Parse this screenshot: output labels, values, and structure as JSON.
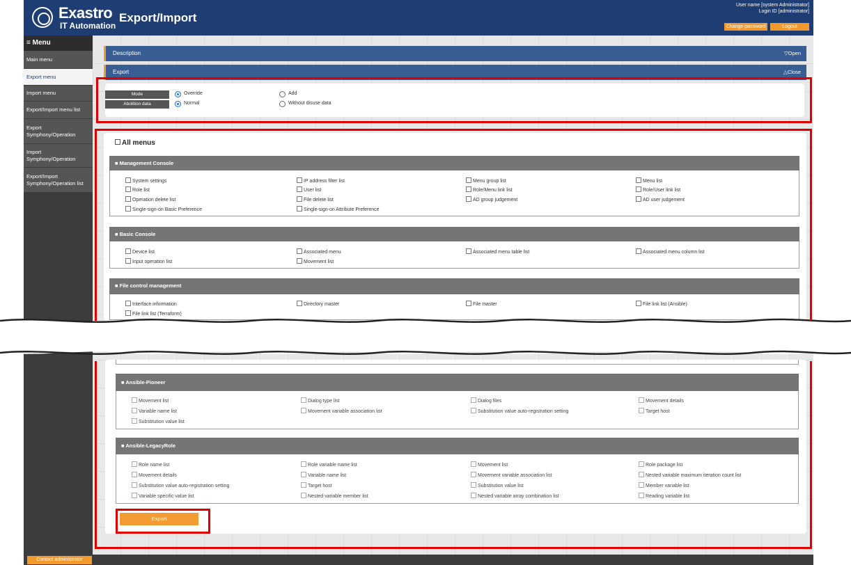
{
  "header": {
    "logo_name": "Exastro",
    "logo_sub": "IT Automation",
    "title": "Export/Import",
    "user_name": "User name [system Administrator]",
    "login_id": "Login ID [administrator]",
    "change_password": "Change password",
    "logout": "Logout"
  },
  "sidebar": {
    "heading": "≡ Menu",
    "items": [
      {
        "label": "Main menu"
      },
      {
        "label": "Export menu"
      },
      {
        "label": "Import menu"
      },
      {
        "label": "Export/Import menu list"
      },
      {
        "label": "Export Symphony/Operation"
      },
      {
        "label": "Import Symphony/Operation"
      },
      {
        "label": "Export/Import Symphony/Operation list"
      }
    ]
  },
  "bars": {
    "description": "Description",
    "description_toggle": "▽Open",
    "export": "Export",
    "export_toggle": "△Close"
  },
  "mode": {
    "mode_label": "Mode",
    "abolition_label": "Abolition data",
    "override": "Override",
    "add": "Add",
    "normal": "Normal",
    "without_disuse": "Without disuse data"
  },
  "all_menus": "All menus",
  "groups": {
    "mgmt": {
      "title": "Management Console",
      "items": [
        "System settings",
        "IP address filter list",
        "Menu group list",
        "Menu list",
        "Role list",
        "User list",
        "Role/Menu link list",
        "Role/User link list",
        "Operation delete list",
        "File delete list",
        "AD group judgement",
        "AD user judgement",
        "Single-sign-on Basic Preference",
        "Single-sign-on Attribute Preference"
      ]
    },
    "basic": {
      "title": "Basic Console",
      "items": [
        "Device list",
        "Associated menu",
        "Associated menu table list",
        "Associated menu column list",
        "Input operation list",
        "Movement list"
      ]
    },
    "file": {
      "title": "File control management",
      "items": [
        "Interface information",
        "Directory master",
        "File master",
        "File link list (Ansible)",
        "File link list (Terraform)"
      ]
    },
    "pioneer": {
      "title": "Ansible-Pioneer",
      "items": [
        "Movement list",
        "Dialog type list",
        "Dialog files",
        "Movement details",
        "Variable name list",
        "Movement variable association list",
        "Substitution value auto-registration setting",
        "Target host",
        "Substitution value list"
      ]
    },
    "legacy": {
      "title": "Ansible-LegacyRole",
      "items": [
        "Role name list",
        "Role variable name list",
        "Movement list",
        "Role package list",
        "Movement details",
        "Variable name list",
        "Movement variable association list",
        "Nested variable maximum iteration count list",
        "Substitution value auto-registration setting",
        "Target host",
        "Substitution value list",
        "Member variable list",
        "Variable specific value list",
        "Nested variable member list",
        "Nested variable array combination list",
        "Reading variable list"
      ]
    }
  },
  "export_button": "Export",
  "footer": {
    "contact": "Contact administrator"
  }
}
